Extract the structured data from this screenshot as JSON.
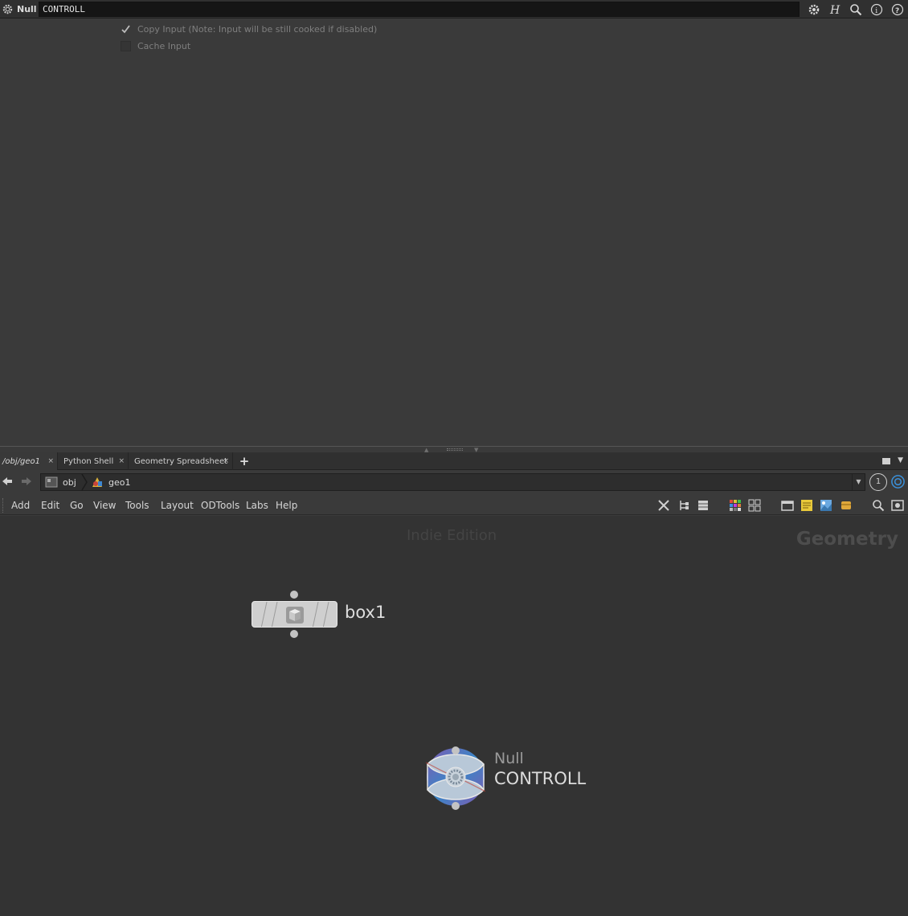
{
  "param_header": {
    "node_type_label": "Null",
    "node_name_value": "CONTROLL",
    "icons": [
      "gear-menu-icon",
      "houdini-help-icon",
      "search-icon",
      "info-icon",
      "help-icon"
    ]
  },
  "parameters": {
    "copy_input": {
      "label": "Copy Input (Note: Input will be still cooked if disabled)",
      "checked": true
    },
    "cache_input": {
      "label": "Cache Input",
      "checked": false
    }
  },
  "tabs": [
    {
      "label": "/obj/geo1",
      "active": true
    },
    {
      "label": "Python Shell",
      "active": false
    },
    {
      "label": "Geometry Spreadsheet",
      "active": false
    }
  ],
  "tab_close_glyph": "×",
  "tab_add_glyph": "+",
  "path": {
    "crumbs": [
      "obj",
      "geo1"
    ],
    "pin_label": "1"
  },
  "menu": {
    "items": [
      "Add",
      "Edit",
      "Go",
      "View",
      "Tools",
      "Layout",
      "ODTools",
      "Labs",
      "Help"
    ]
  },
  "network": {
    "watermark": "Indie Edition",
    "context": "Geometry",
    "nodes": [
      {
        "name": "box1",
        "type_label": ""
      },
      {
        "name": "CONTROLL",
        "type_label": "Null"
      }
    ]
  },
  "colors": {
    "panel_bg": "#3a3a3a",
    "network_bg": "#333333",
    "null_node_blue": "#3a8fd8",
    "null_node_purple": "#8a5fc0"
  }
}
